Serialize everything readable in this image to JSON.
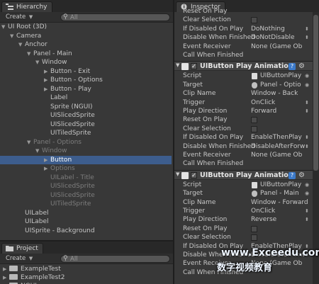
{
  "hierarchy": {
    "tab_label": "Hierarchy",
    "create_label": "Create",
    "search_placeholder": "All",
    "rows": [
      {
        "label": "UI Root (3D)",
        "depth": 0,
        "fold": "open"
      },
      {
        "label": "Camera",
        "depth": 1,
        "fold": "open"
      },
      {
        "label": "Anchor",
        "depth": 2,
        "fold": "open"
      },
      {
        "label": "Panel - Main",
        "depth": 3,
        "fold": "open"
      },
      {
        "label": "Window",
        "depth": 4,
        "fold": "open"
      },
      {
        "label": "Button - Exit",
        "depth": 5,
        "fold": "closed"
      },
      {
        "label": "Button - Options",
        "depth": 5,
        "fold": "closed"
      },
      {
        "label": "Button - Play",
        "depth": 5,
        "fold": "closed"
      },
      {
        "label": "Label",
        "depth": 5,
        "fold": "none"
      },
      {
        "label": "Sprite (NGUI)",
        "depth": 5,
        "fold": "none"
      },
      {
        "label": "UISlicedSprite",
        "depth": 5,
        "fold": "none"
      },
      {
        "label": "UISlicedSprite",
        "depth": 5,
        "fold": "none"
      },
      {
        "label": "UITiledSprite",
        "depth": 5,
        "fold": "none"
      },
      {
        "label": "Panel - Options",
        "depth": 3,
        "fold": "open",
        "dim": true
      },
      {
        "label": "Window",
        "depth": 4,
        "fold": "open",
        "dim": true
      },
      {
        "label": "Button",
        "depth": 5,
        "fold": "closed",
        "selected": true
      },
      {
        "label": "Options",
        "depth": 5,
        "fold": "closed",
        "dim": true
      },
      {
        "label": "UILabel - Title",
        "depth": 5,
        "fold": "none",
        "dim": true
      },
      {
        "label": "UISlicedSprite",
        "depth": 5,
        "fold": "none",
        "dim": true
      },
      {
        "label": "UISlicedSprite",
        "depth": 5,
        "fold": "none",
        "dim": true
      },
      {
        "label": "UITiledSprite",
        "depth": 5,
        "fold": "none",
        "dim": true
      },
      {
        "label": "UILabel",
        "depth": 2,
        "fold": "none"
      },
      {
        "label": "UILabel",
        "depth": 2,
        "fold": "none"
      },
      {
        "label": "UISprite - Background",
        "depth": 2,
        "fold": "none"
      }
    ]
  },
  "project": {
    "tab_label": "Project",
    "create_label": "Create",
    "search_placeholder": "All",
    "items": [
      "ExampleTest",
      "ExampleTest2",
      "NGUI"
    ]
  },
  "inspector": {
    "tab_label": "Inspector",
    "top_rows": [
      {
        "label": "Reset On Play",
        "type": "text",
        "value": ""
      },
      {
        "label": "Clear Selection",
        "type": "check"
      },
      {
        "label": "If Disabled On Play",
        "type": "select",
        "value": "DoNothing"
      },
      {
        "label": "Disable When Finished",
        "type": "select",
        "value": "DoNotDisable"
      },
      {
        "label": "Event Receiver",
        "type": "text",
        "value": "None (Game Ob"
      },
      {
        "label": "Call When Finished",
        "type": "text",
        "value": ""
      }
    ],
    "components": [
      {
        "title": "UIButton Play Animation",
        "help": "?",
        "gear": "⚙",
        "rows": [
          {
            "label": "Script",
            "type": "object",
            "value": "UIButtonPlay"
          },
          {
            "label": "Target",
            "type": "object",
            "value": "Panel - Optio"
          },
          {
            "label": "Clip Name",
            "type": "text",
            "value": "Window - Back"
          },
          {
            "label": "Trigger",
            "type": "select",
            "value": "OnClick"
          },
          {
            "label": "Play Direction",
            "type": "select",
            "value": "Forward"
          },
          {
            "label": "Reset On Play",
            "type": "check"
          },
          {
            "label": "Clear Selection",
            "type": "check"
          },
          {
            "label": "If Disabled On Play",
            "type": "select",
            "value": "EnableThenPlay"
          },
          {
            "label": "Disable When Finished",
            "type": "select",
            "value": "DisableAfterForw"
          },
          {
            "label": "Event Receiver",
            "type": "text",
            "value": "None (Game Ob"
          },
          {
            "label": "Call When Finished",
            "type": "text",
            "value": ""
          }
        ]
      },
      {
        "title": "UIButton Play Animation",
        "help": "?",
        "gear": "⚙",
        "rows": [
          {
            "label": "Script",
            "type": "object",
            "value": "UIButtonPlay"
          },
          {
            "label": "Target",
            "type": "object",
            "value": "Panel - Main"
          },
          {
            "label": "Clip Name",
            "type": "text",
            "value": "Window - Forward"
          },
          {
            "label": "Trigger",
            "type": "select",
            "value": "OnClick"
          },
          {
            "label": "Play Direction",
            "type": "select",
            "value": "Reverse"
          },
          {
            "label": "Reset On Play",
            "type": "check"
          },
          {
            "label": "Clear Selection",
            "type": "check"
          },
          {
            "label": "If Disabled On Play",
            "type": "select",
            "value": "EnableThenPlay"
          },
          {
            "label": "Disable When Finished",
            "type": "select",
            "value": "DisableAfterForw"
          },
          {
            "label": "Event Receiver",
            "type": "text",
            "value": "None (Game Ob"
          },
          {
            "label": "Call When Finished",
            "type": "text",
            "value": ""
          }
        ]
      }
    ]
  },
  "watermark": {
    "url": "www.Exceedu.com",
    "cn": "数字视频教育"
  },
  "colors": {
    "panel_bg": "#383838",
    "selection": "#3d5d8d",
    "tab_bg": "#282828",
    "help_icon": "#3b79c9"
  }
}
